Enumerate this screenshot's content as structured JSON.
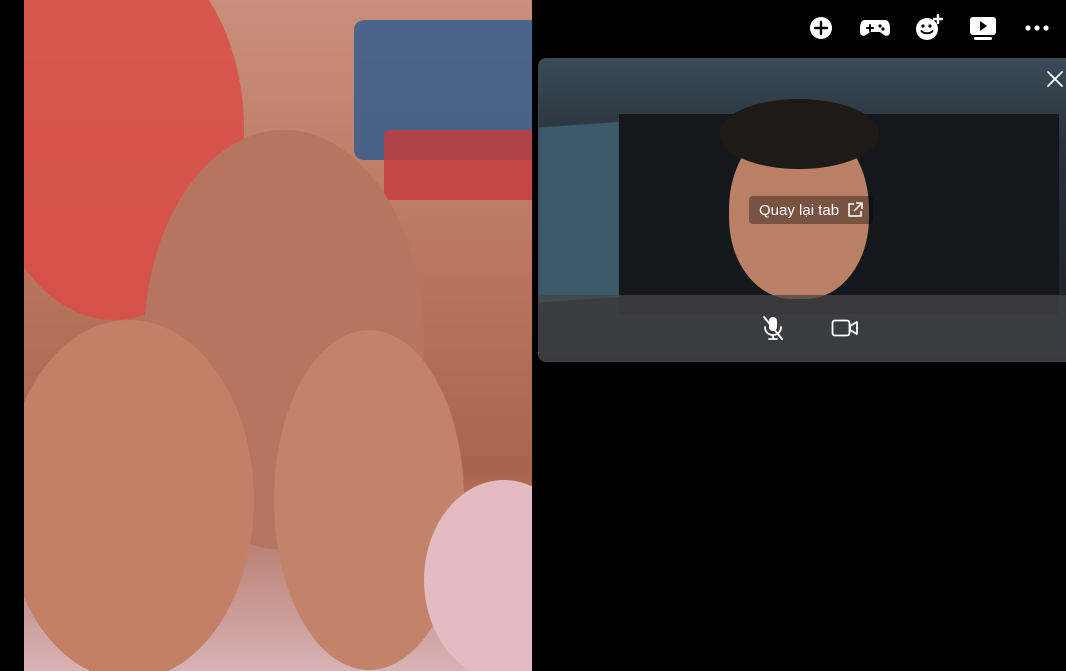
{
  "main_video": {
    "participant": "remote-caller"
  },
  "topbar": {
    "buttons": [
      {
        "icon": "add-circle-icon"
      },
      {
        "icon": "gamepad-icon"
      },
      {
        "icon": "add-emoji-icon"
      },
      {
        "icon": "play-icon"
      },
      {
        "icon": "more-icon"
      }
    ]
  },
  "pip": {
    "back_to_tab_label": "Quay lại tab",
    "controls": {
      "mic_icon": "mic-off-icon",
      "camera_icon": "camera-icon"
    }
  },
  "colors": {
    "background": "#000000",
    "icon": "#ffffff",
    "control_bar": "#464646"
  }
}
